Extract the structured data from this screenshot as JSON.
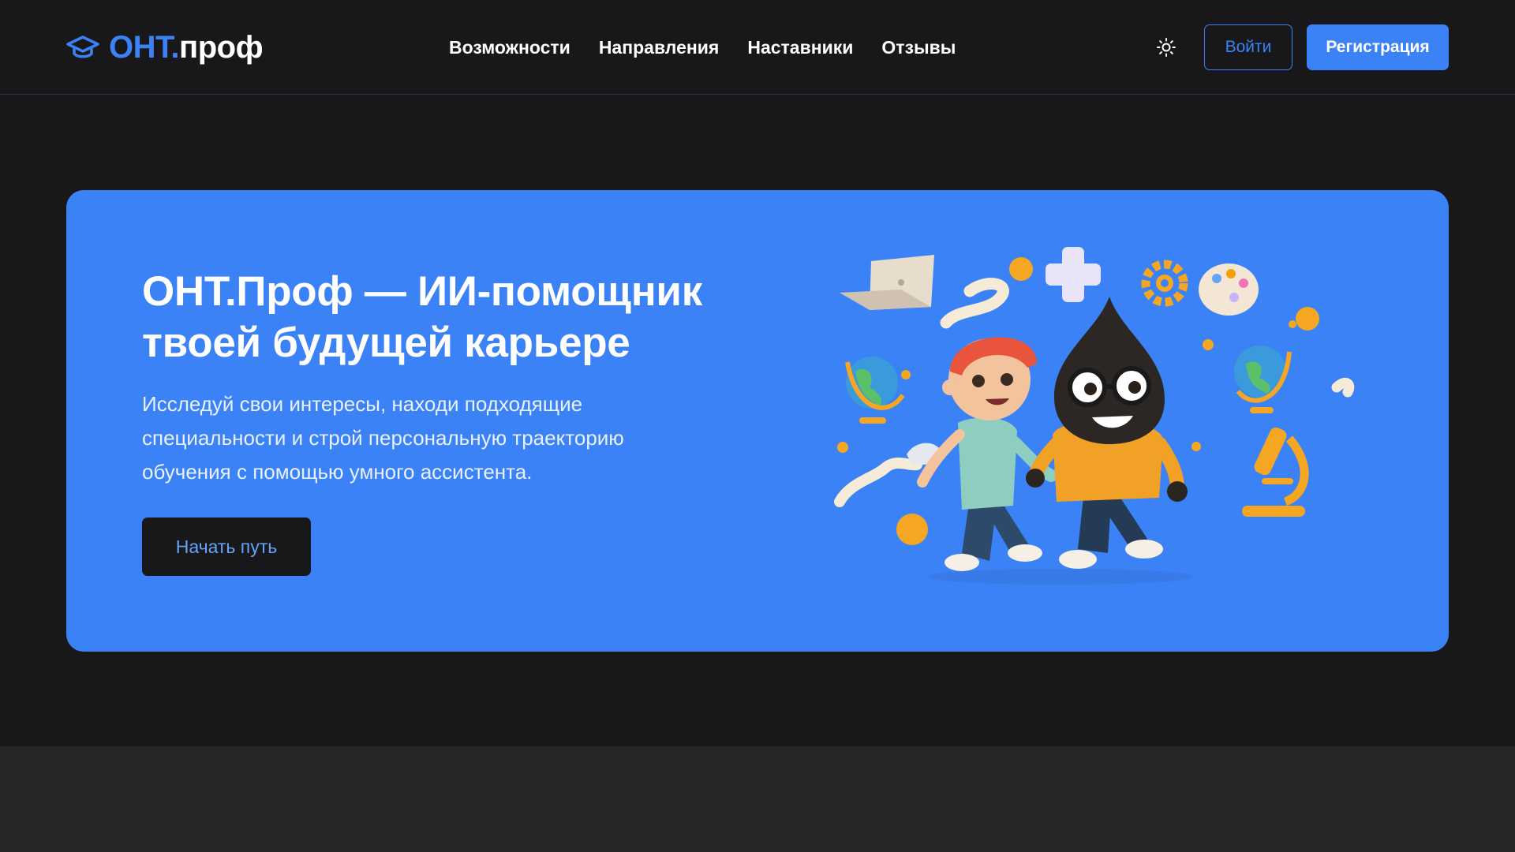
{
  "header": {
    "logo": {
      "accent": "ОНТ.",
      "rest": "проф",
      "icon": "graduation-cap-icon"
    },
    "nav": [
      {
        "label": "Возможности"
      },
      {
        "label": "Направления"
      },
      {
        "label": "Наставники"
      },
      {
        "label": "Отзывы"
      }
    ],
    "theme_toggle_icon": "sun-icon",
    "login_label": "Войти",
    "register_label": "Регистрация"
  },
  "hero": {
    "title_line1": "ОНТ.Проф — ИИ-помощник",
    "title_line2": "твоей будущей карьере",
    "subtitle_line1": "Исследуй свои интересы, находи подходящие",
    "subtitle_line2": "специальности и строй персональную траекторию",
    "subtitle_line3": "обучения с помощью умного ассистента.",
    "cta_label": "Начать путь",
    "illustration": "kids-career-illustration"
  },
  "colors": {
    "background": "#18181b",
    "accent": "#3b82f6",
    "hero_background": "#3b82f6",
    "band": "#262629"
  }
}
